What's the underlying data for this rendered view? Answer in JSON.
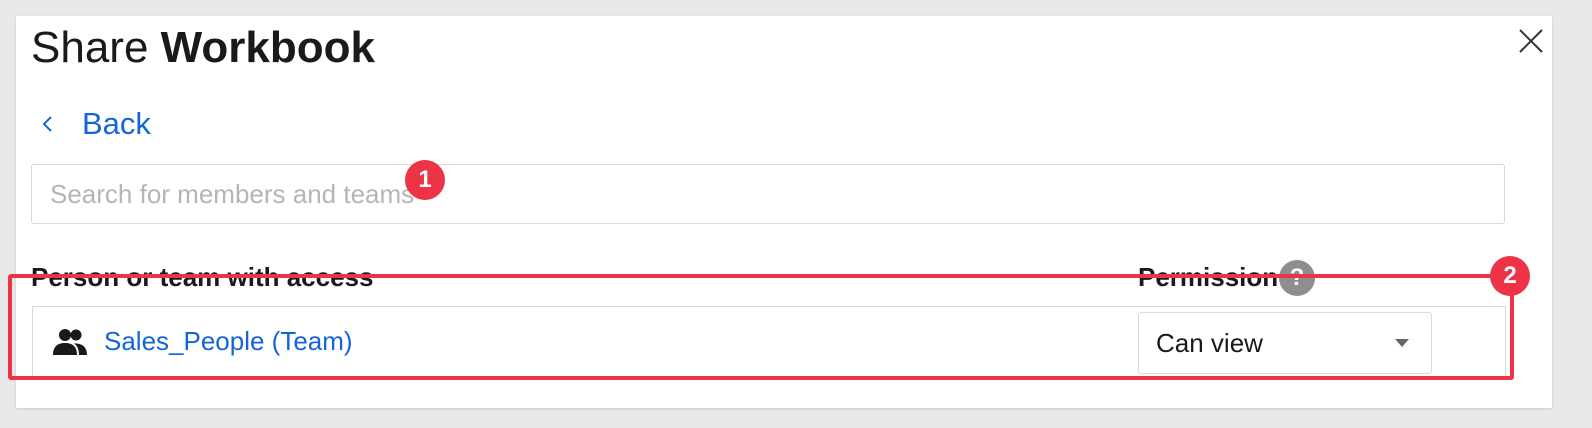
{
  "dialog": {
    "title_prefix": "Share",
    "title_main": "Workbook",
    "close_icon": "close-icon"
  },
  "nav": {
    "back_label": "Back",
    "back_icon": "chevron-left-icon"
  },
  "search": {
    "placeholder": "Search for members and teams",
    "value": ""
  },
  "annotations": {
    "badge_1": "1",
    "badge_2": "2",
    "color": "#ec3446"
  },
  "access_table": {
    "col_person": "Person or team with access",
    "col_permission": "Permission",
    "help_glyph": "?",
    "rows": [
      {
        "icon": "team-icon",
        "name": "Sales_People (Team)",
        "permission": "Can view"
      }
    ]
  },
  "colors": {
    "link": "#1565d8",
    "accent_red": "#ec3446",
    "help_grey": "#8e8e8e"
  }
}
